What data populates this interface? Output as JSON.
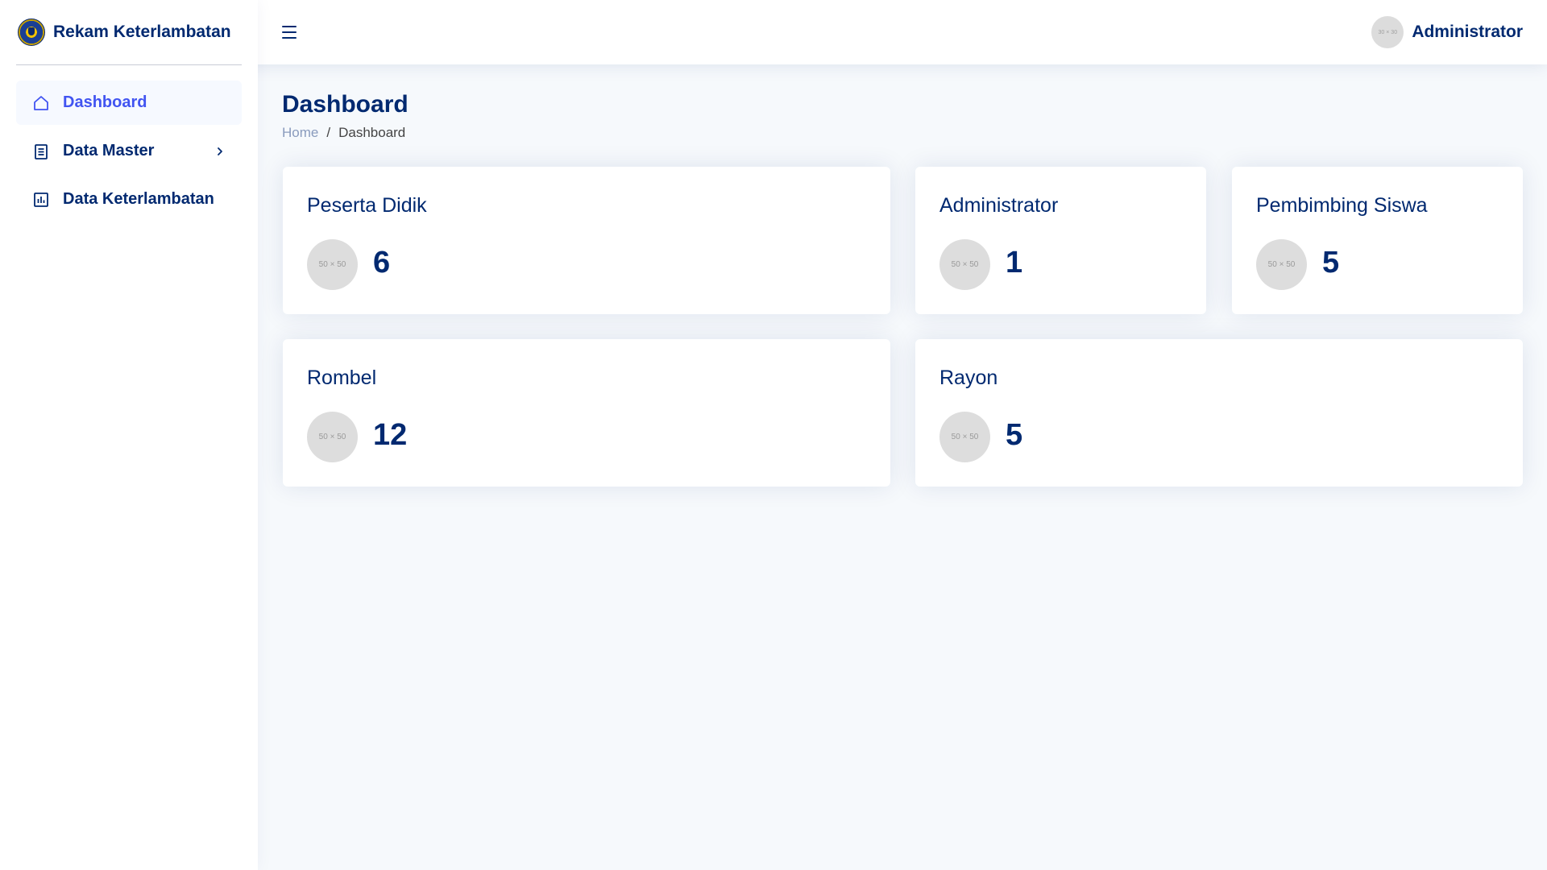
{
  "app": {
    "title": "Rekam Keterlambatan"
  },
  "header": {
    "toggle_icon": "hamburger-menu-icon",
    "profile": {
      "avatar_text": "30 × 30",
      "name": "Administrator"
    }
  },
  "sidebar": {
    "items": [
      {
        "label": "Dashboard",
        "icon": "house-icon",
        "active": true
      },
      {
        "label": "Data Master",
        "icon": "document-list-icon",
        "has_submenu": true
      },
      {
        "label": "Data Keterlambatan",
        "icon": "bar-chart-icon"
      }
    ]
  },
  "page": {
    "title": "Dashboard",
    "breadcrumb": {
      "home": "Home",
      "separator": "/",
      "current": "Dashboard"
    }
  },
  "cards": [
    {
      "title": "Peserta Didik",
      "icon_text": "50 × 50",
      "value": "6"
    },
    {
      "title": "Administrator",
      "icon_text": "50 × 50",
      "value": "1"
    },
    {
      "title": "Pembimbing Siswa",
      "icon_text": "50 × 50",
      "value": "5"
    },
    {
      "title": "Rombel",
      "icon_text": "50 × 50",
      "value": "12"
    },
    {
      "title": "Rayon",
      "icon_text": "50 × 50",
      "value": "5"
    }
  ],
  "colors": {
    "primary": "#012970",
    "accent": "#4154f1",
    "background": "#f6f9fc",
    "placeholder": "#dddddd"
  }
}
